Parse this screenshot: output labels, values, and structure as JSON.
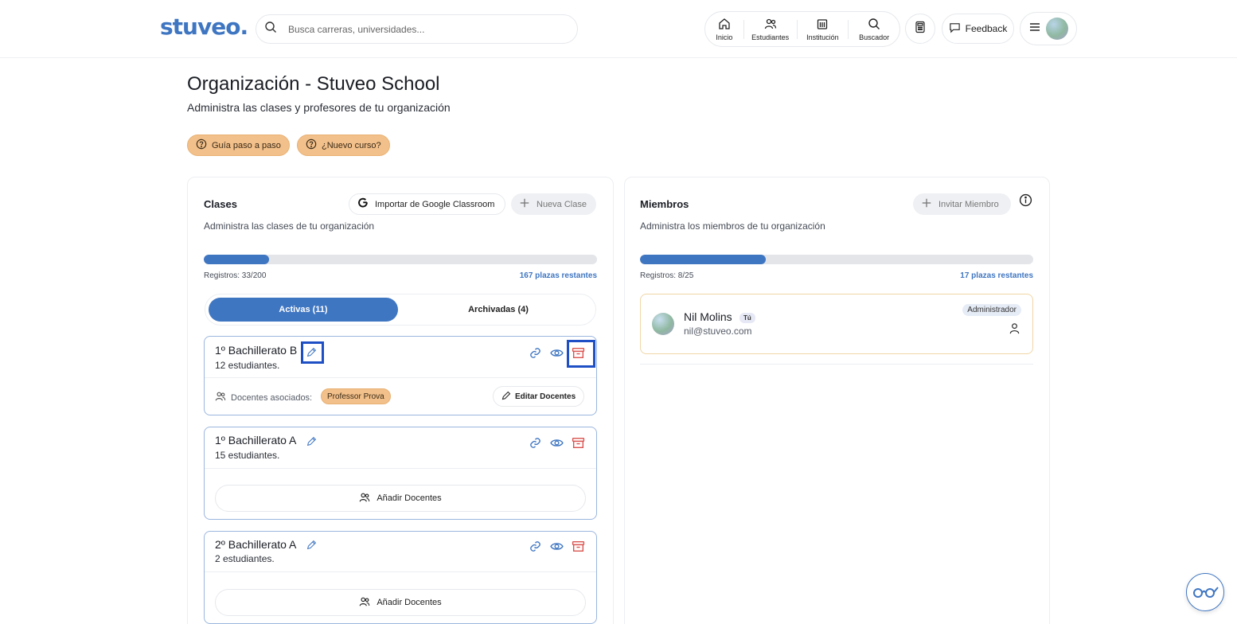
{
  "header": {
    "logo": "stuveo.",
    "search_placeholder": "Busca carreras, universidades...",
    "nav": [
      {
        "label": "Inicio",
        "icon": "home-icon"
      },
      {
        "label": "Estudiantes",
        "icon": "users-icon"
      },
      {
        "label": "Institución",
        "icon": "building-icon"
      },
      {
        "label": "Buscador",
        "icon": "search-icon"
      }
    ],
    "feedback_label": "Feedback"
  },
  "page": {
    "title": "Organización - Stuveo School",
    "subtitle": "Administra las clases y profesores de tu organización",
    "guide_label": "Guía paso a paso",
    "new_course_label": "¿Nuevo curso?"
  },
  "classes": {
    "title": "Clases",
    "description": "Administra las clases de tu organización",
    "import_label": "Importar de Google Classroom",
    "new_class_label": "Nueva Clase",
    "registros": "Registros: 33/200",
    "remaining": "167 plazas restantes",
    "progress": 0.165,
    "tab_active": "Activas (11)",
    "tab_archived": "Archivadas (4)",
    "items": [
      {
        "name": "1º Bachillerato B",
        "students": "12 estudiantes.",
        "docentes_label": "Docentes asociados:",
        "teacher": "Professor Prova",
        "edit_label": "Editar Docentes"
      },
      {
        "name": "1º Bachillerato A",
        "students": "15 estudiantes.",
        "add_label": "Añadir Docentes"
      },
      {
        "name": "2º Bachillerato A",
        "students": "2 estudiantes.",
        "add_label": "Añadir Docentes"
      }
    ]
  },
  "members": {
    "title": "Miembros",
    "description": "Administra los miembros de tu organización",
    "invite_label": "Invitar Miembro",
    "registros": "Registros: 8/25",
    "remaining": "17 plazas restantes",
    "progress": 0.32,
    "list": [
      {
        "name": "Nil Molins",
        "badge": "Tú",
        "email": "nil@stuveo.com",
        "role": "Administrador"
      }
    ]
  },
  "colors": {
    "brand": "#3f76c2",
    "accent": "#f2c08a",
    "danger": "#d9534f"
  }
}
